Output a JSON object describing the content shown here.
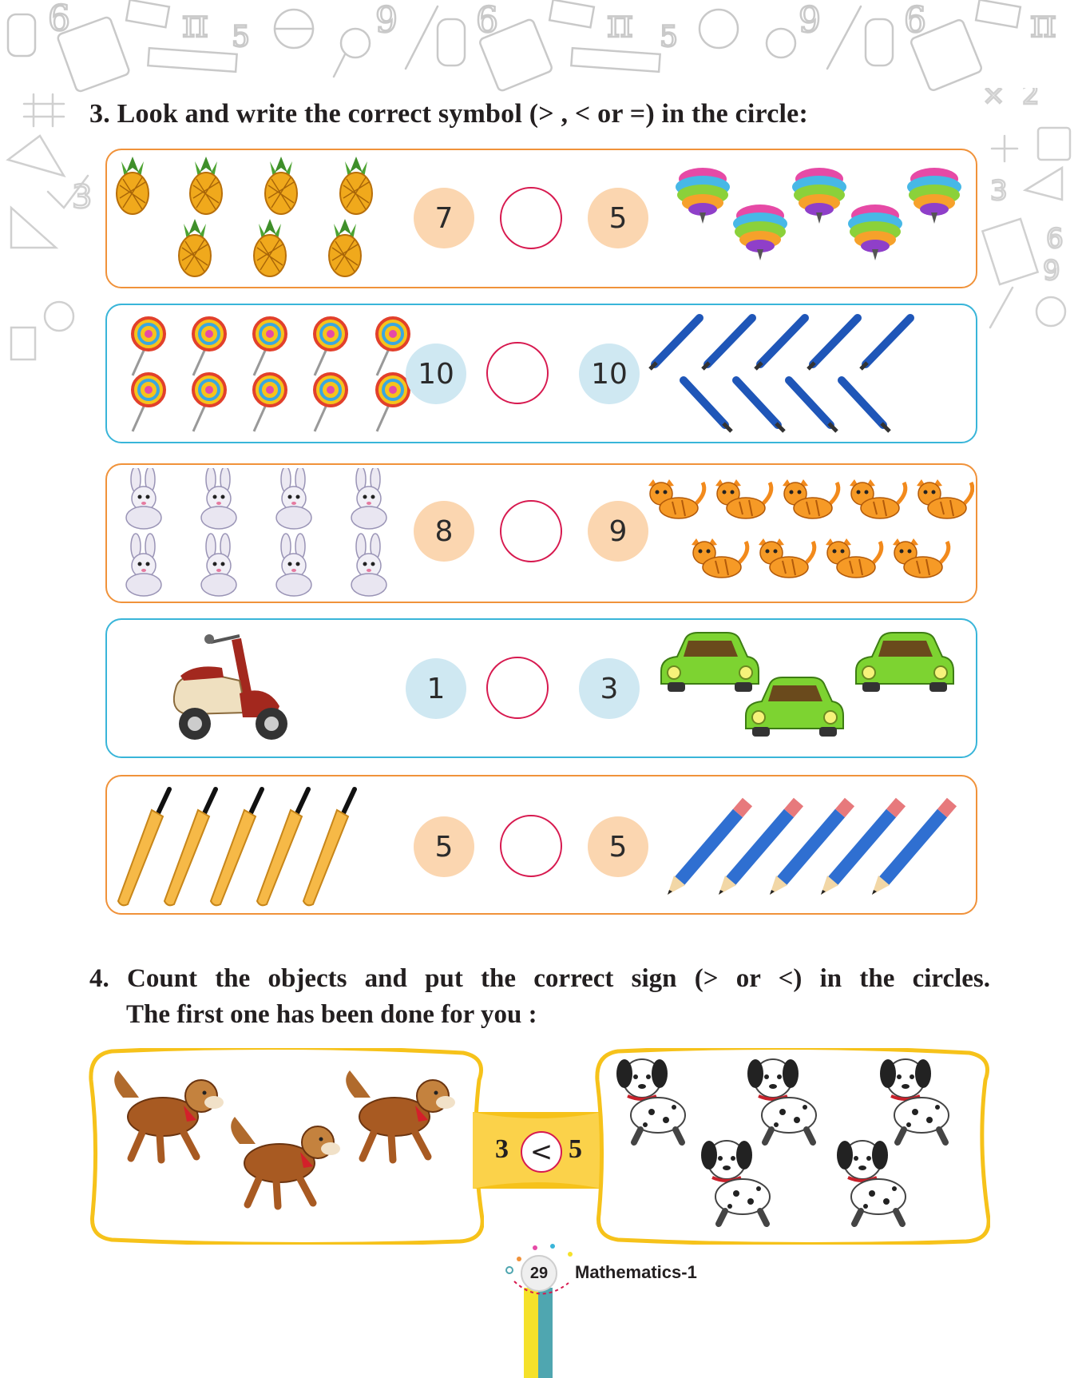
{
  "q3": {
    "heading": "3.  Look and write the correct symbol (> , < or =) in the circle:",
    "rows": [
      {
        "left_value": "7",
        "right_value": "5",
        "left_items": "pineapple",
        "right_items": "spinning-top"
      },
      {
        "left_value": "10",
        "right_value": "10",
        "left_items": "lollipop",
        "right_items": "pen"
      },
      {
        "left_value": "8",
        "right_value": "9",
        "left_items": "rabbit",
        "right_items": "cat"
      },
      {
        "left_value": "1",
        "right_value": "3",
        "left_items": "scooter",
        "right_items": "car"
      },
      {
        "left_value": "5",
        "right_value": "5",
        "left_items": "cricket-bat",
        "right_items": "pencil"
      }
    ]
  },
  "q4": {
    "heading_line1": "4. Count the objects and put the correct sign (> or <) in the circles.",
    "heading_line2": "The first one has been done for you :",
    "example": {
      "left_value": "3",
      "sign": "<",
      "right_value": "5",
      "left_items": "dog",
      "right_items": "dalmatian-puppy"
    }
  },
  "footer": {
    "page_number": "29",
    "book_title": "Mathematics-1"
  },
  "colors": {
    "orange_border": "#f0923a",
    "blue_border": "#39b5d9",
    "answer_circle": "#d7194f",
    "peach": "#fbd6b0",
    "sky": "#cfe8f2",
    "yellow_panel": "#f6c21a"
  }
}
